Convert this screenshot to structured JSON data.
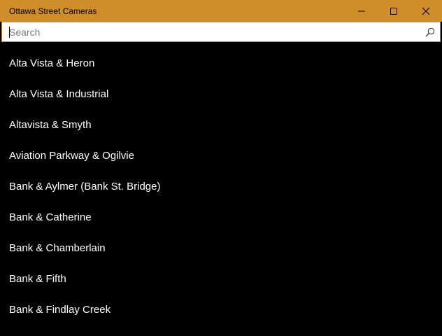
{
  "window": {
    "title": "Ottawa Street Cameras",
    "accent_color": "#CF8E2A",
    "caption_buttons": [
      "minimize-icon",
      "maximize-icon",
      "close-icon"
    ]
  },
  "search": {
    "placeholder": "Search",
    "value": "",
    "icon": "search-icon"
  },
  "cameras": [
    {
      "label": "Alta Vista & Heron"
    },
    {
      "label": "Alta Vista & Industrial"
    },
    {
      "label": "Altavista & Smyth"
    },
    {
      "label": "Aviation Parkway & Ogilvie"
    },
    {
      "label": "Bank & Aylmer (Bank St. Bridge)"
    },
    {
      "label": "Bank & Catherine"
    },
    {
      "label": "Bank & Chamberlain"
    },
    {
      "label": "Bank & Fifth"
    },
    {
      "label": "Bank & Findlay Creek"
    }
  ]
}
